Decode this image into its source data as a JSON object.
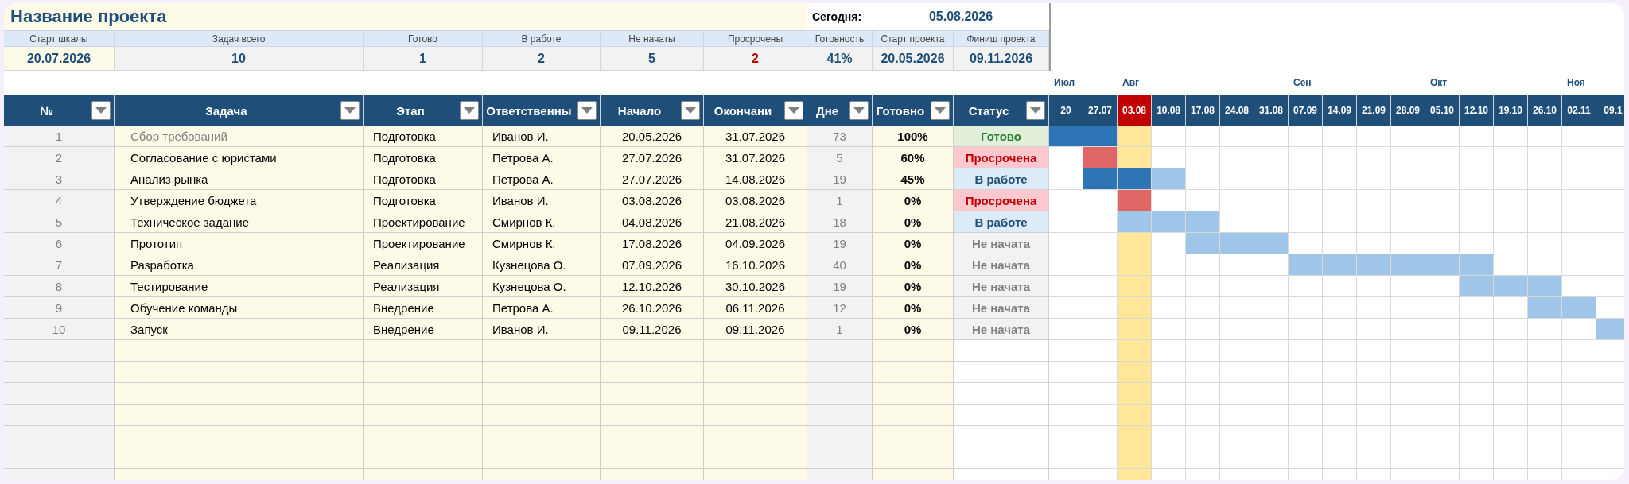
{
  "title": "Название проекта",
  "today": {
    "label": "Сегодня:",
    "value": "05.08.2026"
  },
  "summary": [
    {
      "label": "Старт шкалы",
      "value": "20.07.2026",
      "alert": false
    },
    {
      "label": "Задач всего",
      "value": "10",
      "alert": false
    },
    {
      "label": "Готово",
      "value": "1",
      "alert": false
    },
    {
      "label": "В работе",
      "value": "2",
      "alert": false
    },
    {
      "label": "Не начаты",
      "value": "5",
      "alert": false
    },
    {
      "label": "Просрочены",
      "value": "2",
      "alert": true
    },
    {
      "label": "Готовность",
      "value": "41%",
      "alert": false
    },
    {
      "label": "Старт проекта",
      "value": "20.05.2026",
      "alert": false
    },
    {
      "label": "Финиш проекта",
      "value": "09.11.2026",
      "alert": false
    }
  ],
  "columns": [
    "№",
    "Задача",
    "Этап",
    "Ответственны",
    "Начало",
    "Окончани",
    "Дне",
    "Готовно",
    "Статус"
  ],
  "weeks": [
    {
      "label": "20",
      "month": "Июл",
      "today": false
    },
    {
      "label": "27.07",
      "today": false
    },
    {
      "label": "03.08",
      "month": "Авг",
      "today": true
    },
    {
      "label": "10.08",
      "today": false
    },
    {
      "label": "17.08",
      "today": false
    },
    {
      "label": "24.08",
      "today": false
    },
    {
      "label": "31.08",
      "today": false
    },
    {
      "label": "07.09",
      "month": "Сен",
      "today": false
    },
    {
      "label": "14.09",
      "today": false
    },
    {
      "label": "21.09",
      "today": false
    },
    {
      "label": "28.09",
      "today": false
    },
    {
      "label": "05.10",
      "month": "Окт",
      "today": false
    },
    {
      "label": "12.10",
      "today": false
    },
    {
      "label": "19.10",
      "today": false
    },
    {
      "label": "26.10",
      "today": false
    },
    {
      "label": "02.11",
      "month": "Ноя",
      "today": false
    },
    {
      "label": "09.1",
      "today": false
    }
  ],
  "rows": [
    {
      "num": "1",
      "task": "Сбор требований",
      "stage": "Подготовка",
      "owner": "Иванов И.",
      "start": "20.05.2026",
      "end": "31.07.2026",
      "days": "73",
      "progress": "100%",
      "status": "Готово",
      "kind": "done",
      "timeline": [
        {
          "kind": "done"
        },
        {
          "kind": "done"
        },
        {
          "kind": "none"
        },
        {
          "kind": "none"
        },
        {
          "kind": "none"
        },
        {
          "kind": "none"
        },
        {
          "kind": "none"
        },
        {
          "kind": "none"
        },
        {
          "kind": "none"
        },
        {
          "kind": "none"
        },
        {
          "kind": "none"
        },
        {
          "kind": "none"
        },
        {
          "kind": "none"
        },
        {
          "kind": "none"
        },
        {
          "kind": "none"
        },
        {
          "kind": "none"
        },
        {
          "kind": "none"
        }
      ]
    },
    {
      "num": "2",
      "task": "Согласование с юристами",
      "stage": "Подготовка",
      "owner": "Петрова А.",
      "start": "27.07.2026",
      "end": "31.07.2026",
      "days": "5",
      "progress": "60%",
      "status": "Просрочена",
      "kind": "overdue",
      "timeline": [
        {
          "kind": "none"
        },
        {
          "kind": "late"
        },
        {
          "kind": "none"
        },
        {
          "kind": "none"
        },
        {
          "kind": "none"
        },
        {
          "kind": "none"
        },
        {
          "kind": "none"
        },
        {
          "kind": "none"
        },
        {
          "kind": "none"
        },
        {
          "kind": "none"
        },
        {
          "kind": "none"
        },
        {
          "kind": "none"
        },
        {
          "kind": "none"
        },
        {
          "kind": "none"
        },
        {
          "kind": "none"
        },
        {
          "kind": "none"
        },
        {
          "kind": "none"
        }
      ]
    },
    {
      "num": "3",
      "task": "Анализ рынка",
      "stage": "Подготовка",
      "owner": "Петрова А.",
      "start": "27.07.2026",
      "end": "14.08.2026",
      "days": "19",
      "progress": "45%",
      "status": "В работе",
      "kind": "active",
      "timeline": [
        {
          "kind": "none"
        },
        {
          "kind": "done"
        },
        {
          "kind": "done"
        },
        {
          "kind": "plan"
        },
        {
          "kind": "none"
        },
        {
          "kind": "none"
        },
        {
          "kind": "none"
        },
        {
          "kind": "none"
        },
        {
          "kind": "none"
        },
        {
          "kind": "none"
        },
        {
          "kind": "none"
        },
        {
          "kind": "none"
        },
        {
          "kind": "none"
        },
        {
          "kind": "none"
        },
        {
          "kind": "none"
        },
        {
          "kind": "none"
        },
        {
          "kind": "none"
        }
      ]
    },
    {
      "num": "4",
      "task": "Утверждение бюджета",
      "stage": "Подготовка",
      "owner": "Иванов И.",
      "start": "03.08.2026",
      "end": "03.08.2026",
      "days": "1",
      "progress": "0%",
      "status": "Просрочена",
      "kind": "overdue",
      "timeline": [
        {
          "kind": "none"
        },
        {
          "kind": "none"
        },
        {
          "kind": "late"
        },
        {
          "kind": "none"
        },
        {
          "kind": "none"
        },
        {
          "kind": "none"
        },
        {
          "kind": "none"
        },
        {
          "kind": "none"
        },
        {
          "kind": "none"
        },
        {
          "kind": "none"
        },
        {
          "kind": "none"
        },
        {
          "kind": "none"
        },
        {
          "kind": "none"
        },
        {
          "kind": "none"
        },
        {
          "kind": "none"
        },
        {
          "kind": "none"
        },
        {
          "kind": "none"
        }
      ]
    },
    {
      "num": "5",
      "task": "Техническое задание",
      "stage": "Проектирование",
      "owner": "Смирнов К.",
      "start": "04.08.2026",
      "end": "21.08.2026",
      "days": "18",
      "progress": "0%",
      "status": "В работе",
      "kind": "active",
      "timeline": [
        {
          "kind": "none"
        },
        {
          "kind": "none"
        },
        {
          "kind": "plan"
        },
        {
          "kind": "plan"
        },
        {
          "kind": "plan"
        },
        {
          "kind": "none"
        },
        {
          "kind": "none"
        },
        {
          "kind": "none"
        },
        {
          "kind": "none"
        },
        {
          "kind": "none"
        },
        {
          "kind": "none"
        },
        {
          "kind": "none"
        },
        {
          "kind": "none"
        },
        {
          "kind": "none"
        },
        {
          "kind": "none"
        },
        {
          "kind": "none"
        },
        {
          "kind": "none"
        }
      ]
    },
    {
      "num": "6",
      "task": "Прототип",
      "stage": "Проектирование",
      "owner": "Смирнов К.",
      "start": "17.08.2026",
      "end": "04.09.2026",
      "days": "19",
      "progress": "0%",
      "status": "Не начата",
      "kind": "pending",
      "timeline": [
        {
          "kind": "none"
        },
        {
          "kind": "none"
        },
        {
          "kind": "none"
        },
        {
          "kind": "none"
        },
        {
          "kind": "plan"
        },
        {
          "kind": "plan"
        },
        {
          "kind": "plan"
        },
        {
          "kind": "none"
        },
        {
          "kind": "none"
        },
        {
          "kind": "none"
        },
        {
          "kind": "none"
        },
        {
          "kind": "none"
        },
        {
          "kind": "none"
        },
        {
          "kind": "none"
        },
        {
          "kind": "none"
        },
        {
          "kind": "none"
        },
        {
          "kind": "none"
        }
      ]
    },
    {
      "num": "7",
      "task": "Разработка",
      "stage": "Реализация",
      "owner": "Кузнецова О.",
      "start": "07.09.2026",
      "end": "16.10.2026",
      "days": "40",
      "progress": "0%",
      "status": "Не начата",
      "kind": "pending",
      "timeline": [
        {
          "kind": "none"
        },
        {
          "kind": "none"
        },
        {
          "kind": "none"
        },
        {
          "kind": "none"
        },
        {
          "kind": "none"
        },
        {
          "kind": "none"
        },
        {
          "kind": "none"
        },
        {
          "kind": "plan"
        },
        {
          "kind": "plan"
        },
        {
          "kind": "plan"
        },
        {
          "kind": "plan"
        },
        {
          "kind": "plan"
        },
        {
          "kind": "plan"
        },
        {
          "kind": "none"
        },
        {
          "kind": "none"
        },
        {
          "kind": "none"
        },
        {
          "kind": "none"
        }
      ]
    },
    {
      "num": "8",
      "task": "Тестирование",
      "stage": "Реализация",
      "owner": "Кузнецова О.",
      "start": "12.10.2026",
      "end": "30.10.2026",
      "days": "19",
      "progress": "0%",
      "status": "Не начата",
      "kind": "pending",
      "timeline": [
        {
          "kind": "none"
        },
        {
          "kind": "none"
        },
        {
          "kind": "none"
        },
        {
          "kind": "none"
        },
        {
          "kind": "none"
        },
        {
          "kind": "none"
        },
        {
          "kind": "none"
        },
        {
          "kind": "none"
        },
        {
          "kind": "none"
        },
        {
          "kind": "none"
        },
        {
          "kind": "none"
        },
        {
          "kind": "none"
        },
        {
          "kind": "plan"
        },
        {
          "kind": "plan"
        },
        {
          "kind": "plan"
        },
        {
          "kind": "none"
        },
        {
          "kind": "none"
        }
      ]
    },
    {
      "num": "9",
      "task": "Обучение команды",
      "stage": "Внедрение",
      "owner": "Петрова А.",
      "start": "26.10.2026",
      "end": "06.11.2026",
      "days": "12",
      "progress": "0%",
      "status": "Не начата",
      "kind": "pending",
      "timeline": [
        {
          "kind": "none"
        },
        {
          "kind": "none"
        },
        {
          "kind": "none"
        },
        {
          "kind": "none"
        },
        {
          "kind": "none"
        },
        {
          "kind": "none"
        },
        {
          "kind": "none"
        },
        {
          "kind": "none"
        },
        {
          "kind": "none"
        },
        {
          "kind": "none"
        },
        {
          "kind": "none"
        },
        {
          "kind": "none"
        },
        {
          "kind": "none"
        },
        {
          "kind": "none"
        },
        {
          "kind": "plan"
        },
        {
          "kind": "plan"
        },
        {
          "kind": "none"
        }
      ]
    },
    {
      "num": "10",
      "task": "Запуск",
      "stage": "Внедрение",
      "owner": "Иванов И.",
      "start": "09.11.2026",
      "end": "09.11.2026",
      "days": "1",
      "progress": "0%",
      "status": "Не начата",
      "kind": "pending",
      "timeline": [
        {
          "kind": "none"
        },
        {
          "kind": "none"
        },
        {
          "kind": "none"
        },
        {
          "kind": "none"
        },
        {
          "kind": "none"
        },
        {
          "kind": "none"
        },
        {
          "kind": "none"
        },
        {
          "kind": "none"
        },
        {
          "kind": "none"
        },
        {
          "kind": "none"
        },
        {
          "kind": "none"
        },
        {
          "kind": "none"
        },
        {
          "kind": "none"
        },
        {
          "kind": "none"
        },
        {
          "kind": "none"
        },
        {
          "kind": "none"
        },
        {
          "kind": "plan"
        }
      ]
    }
  ]
}
